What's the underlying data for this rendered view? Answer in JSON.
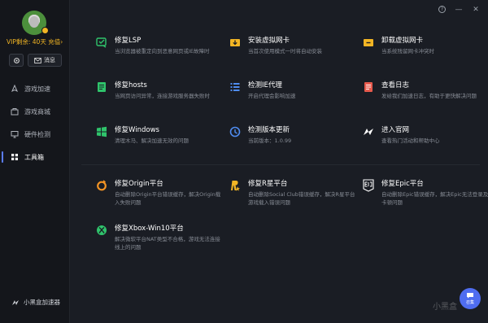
{
  "user": {
    "vip_label": "VIP剩余: 40天",
    "recharge_label": "充值",
    "message_label": "消息"
  },
  "nav": {
    "items": [
      {
        "label": "游戏加速",
        "icon": "rocket-icon",
        "active": false
      },
      {
        "label": "游戏商城",
        "icon": "store-icon",
        "active": false
      },
      {
        "label": "硬件检测",
        "icon": "monitor-icon",
        "active": false
      },
      {
        "label": "工具箱",
        "icon": "toolbox-icon",
        "active": true
      }
    ]
  },
  "brand": {
    "name": "小黑盒加速器"
  },
  "tools": [
    {
      "title": "修复LSP",
      "desc": "当浏览器被重定向到恶意网页或IE故障时",
      "icon": "lsp-repair-icon",
      "color": "#2fc36b"
    },
    {
      "title": "安装虚拟网卡",
      "desc": "当首次使用模式一时将自动安装",
      "icon": "install-nic-icon",
      "color": "#f2b524"
    },
    {
      "title": "卸载虚拟网卡",
      "desc": "当系统残留网卡冲突时",
      "icon": "uninstall-nic-icon",
      "color": "#f2b524"
    },
    {
      "title": "修复hosts",
      "desc": "当网页访问异常，连接游戏服务器失败时",
      "icon": "hosts-repair-icon",
      "color": "#2fc36b"
    },
    {
      "title": "检测IE代理",
      "desc": "开启代理会影响加速",
      "icon": "ie-proxy-icon",
      "color": "#4f8cf0"
    },
    {
      "title": "查看日志",
      "desc": "发给我们加速日志，有助于更快解决问题",
      "icon": "log-icon",
      "color": "#e65a4d"
    },
    {
      "title": "修复Windows",
      "desc": "清理木马、解决加速无效的问题",
      "icon": "windows-icon",
      "color": "#2fc36b"
    },
    {
      "title": "检测版本更新",
      "desc": "当前版本：1.0.99",
      "icon": "update-icon",
      "color": "#4f8cf0"
    },
    {
      "title": "进入官网",
      "desc": "查看热门活动和帮助中心",
      "icon": "website-icon",
      "color": "#ffffff"
    },
    {
      "title": "修复Origin平台",
      "desc": "自动删除Origin平台错误缓存，解决Origin载入失败问题",
      "icon": "origin-icon",
      "color": "#f29324"
    },
    {
      "title": "修复R星平台",
      "desc": "自动删除Social Club错误缓存，解决R星平台游戏载入错误问题",
      "icon": "rockstar-icon",
      "color": "#f2b524"
    },
    {
      "title": "修复Epic平台",
      "desc": "自动删除Epic错误缓存，解决Epic无法登录及卡顿问题",
      "icon": "epic-icon",
      "color": "#ffffff"
    },
    {
      "title": "修复Xbox-Win10平台",
      "desc": "解决微软平台NAT类型不合格，游戏无法连接线上的问题",
      "icon": "xbox-icon",
      "color": "#2fc36b"
    }
  ],
  "chat": {
    "label": "召集"
  },
  "watermark": "小黑盒"
}
